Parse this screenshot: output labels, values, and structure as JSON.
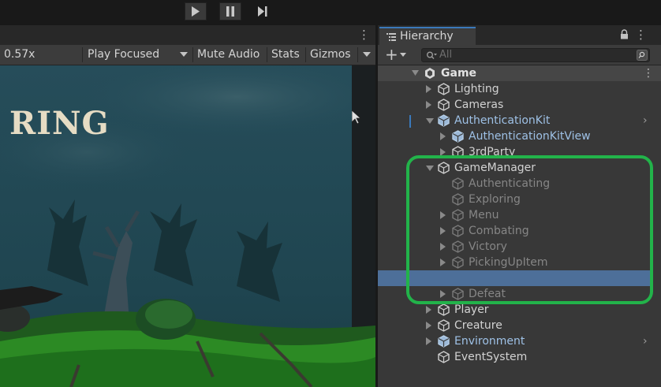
{
  "toolbar": {
    "play_icon": "play-icon",
    "pause_icon": "pause-icon",
    "step_icon": "step-icon"
  },
  "game_view": {
    "zoom": "0.57x",
    "play_mode": "Play Focused",
    "mute_audio": "Mute Audio",
    "stats": "Stats",
    "gizmos": "Gizmos",
    "title_partial": "RING"
  },
  "hierarchy": {
    "tab_label": "Hierarchy",
    "search_placeholder": "All",
    "scene": "Game",
    "items": [
      {
        "label": "Lighting",
        "depth": 1,
        "arrow": "right",
        "state": "normal"
      },
      {
        "label": "Cameras",
        "depth": 1,
        "arrow": "right",
        "state": "normal"
      },
      {
        "label": "AuthenticationKit",
        "depth": 1,
        "arrow": "down",
        "state": "prefab",
        "more": true
      },
      {
        "label": "AuthenticationKitView",
        "depth": 2,
        "arrow": "right",
        "state": "prefab"
      },
      {
        "label": "3rdParty",
        "depth": 2,
        "arrow": "right",
        "state": "normal"
      },
      {
        "label": "GameManager",
        "depth": 1,
        "arrow": "down",
        "state": "normal"
      },
      {
        "label": "Authenticating",
        "depth": 2,
        "arrow": "none",
        "state": "dim"
      },
      {
        "label": "Exploring",
        "depth": 2,
        "arrow": "none",
        "state": "dim"
      },
      {
        "label": "Menu",
        "depth": 2,
        "arrow": "right",
        "state": "dim"
      },
      {
        "label": "Combating",
        "depth": 2,
        "arrow": "right",
        "state": "dim"
      },
      {
        "label": "Victory",
        "depth": 2,
        "arrow": "right",
        "state": "dim"
      },
      {
        "label": "PickingUpItem",
        "depth": 2,
        "arrow": "right",
        "state": "dim"
      },
      {
        "label": "",
        "depth": 2,
        "arrow": "none",
        "state": "selected"
      },
      {
        "label": "Defeat",
        "depth": 2,
        "arrow": "right",
        "state": "dim"
      },
      {
        "label": "Player",
        "depth": 1,
        "arrow": "right",
        "state": "normal"
      },
      {
        "label": "Creature",
        "depth": 1,
        "arrow": "right",
        "state": "normal"
      },
      {
        "label": "Environment",
        "depth": 1,
        "arrow": "right",
        "state": "prefab",
        "more": true
      },
      {
        "label": "EventSystem",
        "depth": 1,
        "arrow": "none",
        "state": "normal"
      }
    ]
  },
  "colors": {
    "selection": "#4d6f99",
    "highlight_outline": "#22b34a",
    "panel_bg": "#383838"
  }
}
